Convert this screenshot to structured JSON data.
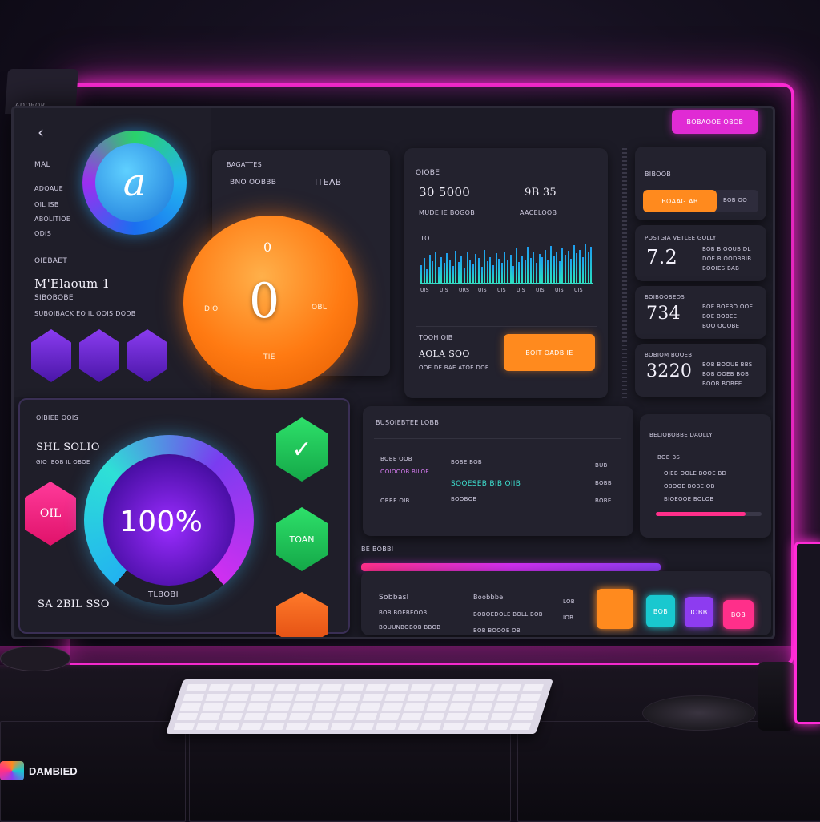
{
  "window": {
    "corner_tab": "ADDBOR"
  },
  "left_column": {
    "nav_items": [
      "MAL",
      "ADOAUE",
      "OIL ISB",
      "ABOLITIOE",
      "ODIS"
    ],
    "section_label": "OIEBAET",
    "title": "M'Elaoum 1",
    "subtitle": "SIBOBOBE",
    "caption": "SUBOIBACK EO IL OOIS DODB",
    "app_logo_glyph": "a"
  },
  "dial_panel": {
    "header_left": "BAGATTES",
    "header_label": "BNO OOBBB",
    "header_value": "ITEAB",
    "dial_value": "0",
    "top_marker": "0",
    "left_label": "DIO",
    "right_label": "OBL",
    "bottom_label": "TIE"
  },
  "chart_panel": {
    "label": "OIOBE",
    "value_1": "30 5000",
    "value_1_caption": "MUDE IE BOGOB",
    "value_2": "9B 35",
    "value_2_caption": "AACELOOB",
    "chart_label": "TO",
    "x_ticks": [
      "UIS",
      "UIS",
      "URS",
      "UIS",
      "UIS",
      "UIS",
      "UIS",
      "UIS",
      "UIS"
    ],
    "sub_label": "TOOH OIB",
    "sub_value": "AOLA SOO",
    "sub_caption": "OOE DE BAE ATOE DOE",
    "action_label": "BOIT OADB IE"
  },
  "chart_data": {
    "type": "bar",
    "title": "",
    "xlabel": "",
    "ylabel": "",
    "values": [
      40,
      55,
      30,
      62,
      48,
      70,
      35,
      58,
      44,
      66,
      52,
      38,
      72,
      46,
      60,
      34,
      68,
      50,
      42,
      64,
      56,
      36,
      74,
      48,
      58,
      40,
      66,
      54,
      44,
      70,
      52,
      62,
      38,
      78,
      46,
      60,
      50,
      80,
      56,
      70,
      44,
      64,
      58,
      74,
      52,
      82,
      60,
      68,
      48,
      76,
      62,
      72,
      54,
      84,
      66,
      74,
      58,
      88,
      70,
      80
    ],
    "ylim": [
      0,
      100
    ],
    "baseline": true
  },
  "right_cards": {
    "search": {
      "label": "BIBOOB",
      "button": "BOAAG AB",
      "field": "BOB OO"
    },
    "cards": [
      {
        "title": "POSTGIA VETLEE GOLLY",
        "value": "7.2",
        "lines": [
          "BOB B OOUB DL",
          "DOE B OODBBIB",
          "BOOIES BAB"
        ]
      },
      {
        "title": "BOIBOOBEDS",
        "value": "734",
        "lines": [
          "BOE BOEBO OOE",
          "BOE BOBEE",
          "BOO OOOBE"
        ]
      },
      {
        "title": "BOBIOM BOOEB",
        "value": "3220",
        "lines": [
          "BOB BOOUE BBS",
          "BOB OOEB BOB",
          "BOOB BOBEE"
        ]
      }
    ],
    "top_button": "BOBAOOE OBOB"
  },
  "gauge_panel": {
    "header": "OIBIEB OOIS",
    "title": "SHL SOLIO",
    "subtitle": "GIO IBOB IL OBOE",
    "percent": "100%",
    "progress_fraction": 1.0,
    "caption": "TLBOBI",
    "bottom_left": "SA 2BIL SSO",
    "hex_label": "OIL",
    "side_icon_label": "TOAN"
  },
  "table_panel": {
    "title": "BUSOIEBTEE LOBB",
    "rows": [
      {
        "col1": "BOBE OOB",
        "col2": "BOBE BOB",
        "col3": "BUB"
      },
      {
        "col1": "OOIOOOB BILOE",
        "col2": "SOOESEB BIB OIIB",
        "col3": "BOBB"
      },
      {
        "col1": "ORRE OIB",
        "col2": "BOOBOB",
        "col3": "BOBE"
      }
    ]
  },
  "mini_panel": {
    "title": "BELIOBOBBE DAOLLY",
    "lines": [
      "BOB BS",
      "OIEB OOLE BOOE BD",
      "OBOOE BOBE OB",
      "BIOEOOE BOLOB"
    ],
    "progress_fraction": 0.85
  },
  "bottom_panel": {
    "label_left": "BE BOBBI",
    "col1_title": "Sobbasl",
    "col1_line1": "BOB BOEBEOOB",
    "col1_line2": "BOUUNBOBOB BBOB",
    "col2_title": "Boobbbe",
    "col2_line1": "BOBOEDOLE BOLL BOB",
    "col2_line2": "BOB BOOOE OB",
    "col3_title": "LOB",
    "col3_line1": "IOB",
    "tiles": [
      {
        "label": "",
        "color": "#ff8a1e"
      },
      {
        "label": "BOB",
        "color": "#19c8cf"
      },
      {
        "label": "IOBB",
        "color": "#8d3cf0"
      },
      {
        "label": "BOB",
        "color": "#ff2f8a"
      }
    ]
  },
  "brand": {
    "text": "DAMBIED"
  },
  "colors": {
    "neon": "#ff2bd6",
    "orange": "#ff8a1e",
    "green": "#23c15a",
    "purple": "#6a20d6",
    "cyan": "#19c8cf",
    "pink": "#ff2f8a"
  },
  "icons": [
    "back-chevron-icon",
    "app-logo-icon",
    "shield-icon",
    "check-icon",
    "arrow-icon"
  ]
}
